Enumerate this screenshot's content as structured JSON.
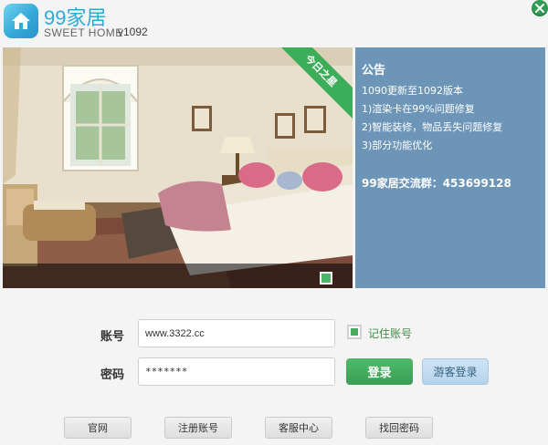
{
  "app": {
    "name": "99家居",
    "subtitle": "SWEET HOME",
    "version": "v1092"
  },
  "banner": {
    "ribbon_label": "今日之星"
  },
  "notice": {
    "title": "公告",
    "lines": [
      "1090更新至1092版本",
      "1)渲染卡在99%问题修复",
      "2)智能装修，物品丢失问题修复",
      "3)部分功能优化"
    ],
    "group": "99家居交流群：453699128"
  },
  "login": {
    "username_label": "账号",
    "username_value": "www.3322.cc",
    "password_label": "密码",
    "password_value": "*******",
    "remember_label": "记住账号",
    "login_button": "登录",
    "guest_button": "游客登录"
  },
  "footer": {
    "links": [
      "官网",
      "注册账号",
      "客服中心",
      "找回密码"
    ]
  },
  "colors": {
    "accent_green": "#3cae5a",
    "notice_bg": "#6c95b7",
    "brand_blue": "#2eaad9"
  }
}
